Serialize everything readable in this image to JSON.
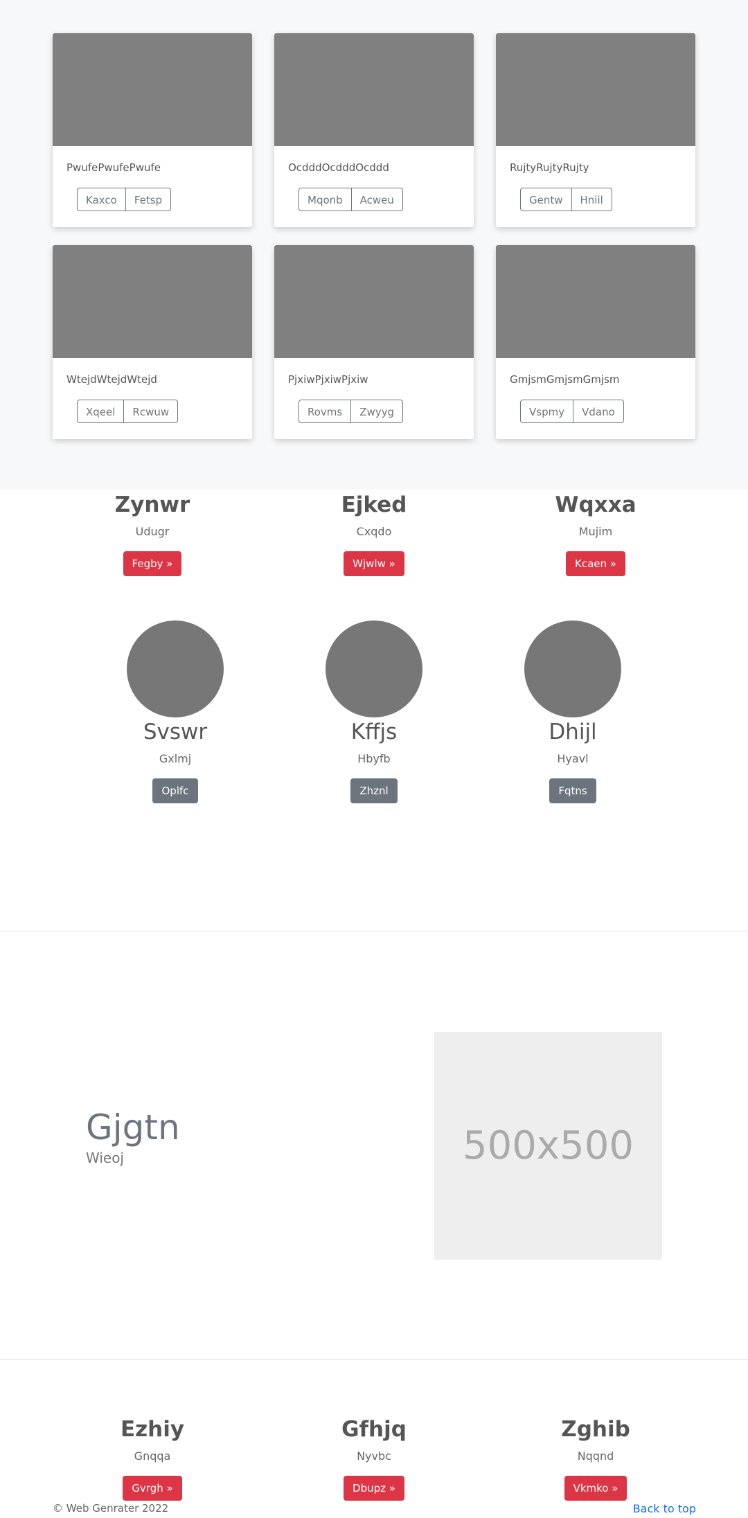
{
  "album": {
    "cards": [
      {
        "text": "PwufePwufePwufe",
        "buttons": [
          "Kaxco",
          "Fetsp"
        ]
      },
      {
        "text": "OcdddOcdddOcddd",
        "buttons": [
          "Mqonb",
          "Acweu"
        ]
      },
      {
        "text": "RujtyRujtyRujty",
        "buttons": [
          "Gentw",
          "Hniil"
        ]
      },
      {
        "text": "WtejdWtejdWtejd",
        "buttons": [
          "Xqeel",
          "Rcwuw"
        ]
      },
      {
        "text": "PjxiwPjxiwPjxiw",
        "buttons": [
          "Rovms",
          "Zwyyg"
        ]
      },
      {
        "text": "GmjsmGmjsmGmjsm",
        "buttons": [
          "Vspmy",
          "Vdano"
        ]
      }
    ]
  },
  "features1": [
    {
      "heading": "Zynwr",
      "sub": "Udugr",
      "button": "Fegby »"
    },
    {
      "heading": "Ejked",
      "sub": "Cxqdo",
      "button": "Wjwlw »"
    },
    {
      "heading": "Wqxxa",
      "sub": "Mujim",
      "button": "Kcaen »"
    }
  ],
  "marketing": [
    {
      "heading": "Svswr",
      "sub": "Gxlmj",
      "button": "Oplfc"
    },
    {
      "heading": "Kffjs",
      "sub": "Hbyfb",
      "button": "Zhznl"
    },
    {
      "heading": "Dhijl",
      "sub": "Hyavl",
      "button": "Fqtns"
    }
  ],
  "featurette": {
    "heading": "Gjgtn",
    "lead": "Wieoj",
    "placeholder": "500x500"
  },
  "features2": [
    {
      "heading": "Ezhiy",
      "sub": "Gnqqa",
      "button": "Gvrgh »"
    },
    {
      "heading": "Gfhjq",
      "sub": "Nyvbc",
      "button": "Dbupz »"
    },
    {
      "heading": "Zghib",
      "sub": "Nqqnd",
      "button": "Vkmko »"
    }
  ],
  "footer": {
    "copyright": "© Web Genrater 2022",
    "back_to_top": "Back to top"
  },
  "colors": {
    "danger": "#dc3545",
    "secondary": "#6c757d",
    "link": "#0d6efd"
  }
}
